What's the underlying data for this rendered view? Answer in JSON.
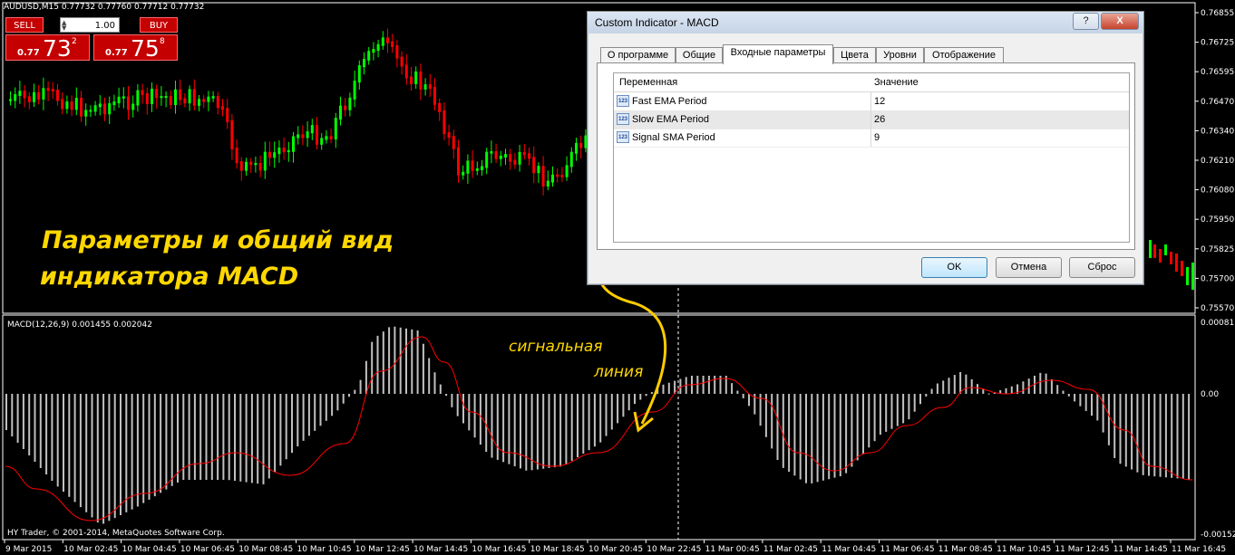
{
  "chart_header": {
    "symbol_line": "AUDUSD,M15  0.77732 0.77760 0.77712 0.77732"
  },
  "trade_panel": {
    "sell_label": "SELL",
    "buy_label": "BUY",
    "lot_value": "1.00",
    "sell_price": {
      "prefix": "0.77",
      "big": "73",
      "sup": "2"
    },
    "buy_price": {
      "prefix": "0.77",
      "big": "75",
      "sup": "8"
    }
  },
  "price_axis": {
    "labels": [
      "0.76855",
      "0.76725",
      "0.76595",
      "0.76470",
      "0.76340",
      "0.76210",
      "0.76080",
      "0.75950",
      "0.75825",
      "0.75700",
      "0.75570"
    ]
  },
  "indicator": {
    "header": "MACD(12,26,9) 0.001455 0.002042",
    "axis_labels": [
      "0.000811",
      "0.00",
      "-0.00152"
    ],
    "copyright": "HY Trader, © 2001-2014, MetaQuotes Software Corp.",
    "hist_color": "#c0c0c0",
    "signal_color": "#ff0000"
  },
  "time_axis": {
    "labels": [
      "9 Mar 2015",
      "10 Mar 02:45",
      "10 Mar 04:45",
      "10 Mar 06:45",
      "10 Mar 08:45",
      "10 Mar 10:45",
      "10 Mar 12:45",
      "10 Mar 14:45",
      "10 Mar 16:45",
      "10 Mar 18:45",
      "10 Mar 20:45",
      "10 Mar 22:45",
      "11 Mar 00:45",
      "11 Mar 02:45",
      "11 Mar 04:45",
      "11 Mar 06:45",
      "11 Mar 08:45",
      "11 Mar 10:45",
      "11 Mar 12:45",
      "11 Mar 14:45",
      "11 Mar 16:45"
    ]
  },
  "candles": {
    "up_color": "#00ff00",
    "down_color": "#ff0000"
  },
  "annotations": {
    "caption_line1": "Параметры и общий вид",
    "caption_line2": "индикатора MACD",
    "signal_line1": "сигнальная",
    "signal_line2": "линия",
    "accent": "#ffd700"
  },
  "dialog": {
    "title": "Custom Indicator - MACD",
    "help_label": "?",
    "close_label": "X",
    "tabs": [
      "О программе",
      "Общие",
      "Входные параметры",
      "Цвета",
      "Уровни",
      "Отображение"
    ],
    "active_tab": "Входные параметры",
    "columns": {
      "variable": "Переменная",
      "value": "Значение"
    },
    "params": [
      {
        "icon": "123",
        "name": "Fast EMA Period",
        "value": "12"
      },
      {
        "icon": "123",
        "name": "Slow EMA Period",
        "value": "26"
      },
      {
        "icon": "123",
        "name": "Signal SMA Period",
        "value": "9"
      }
    ],
    "buttons": {
      "ok": "OK",
      "cancel": "Отмена",
      "reset": "Сброс"
    }
  }
}
